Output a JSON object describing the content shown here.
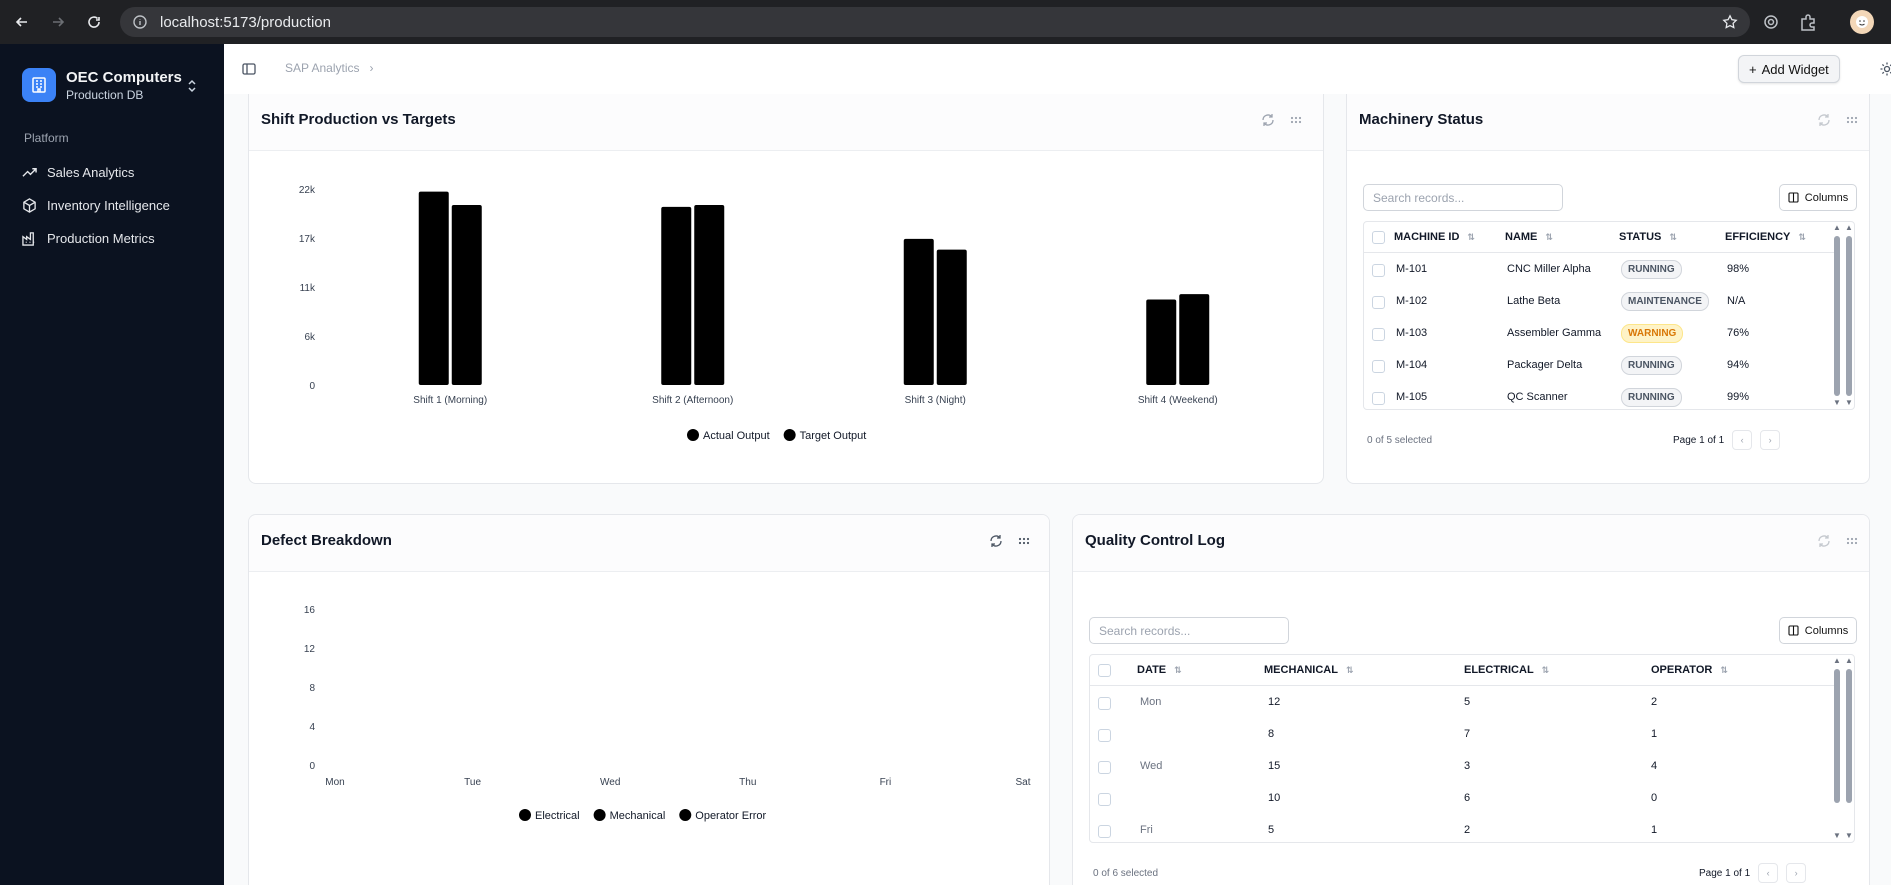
{
  "browser": {
    "url": "localhost:5173/production"
  },
  "sidebar": {
    "org_name": "OEC Computers",
    "org_sub": "Production DB",
    "section_label": "Platform",
    "items": [
      {
        "label": "Sales Analytics",
        "icon": "trending-up-icon"
      },
      {
        "label": "Inventory Intelligence",
        "icon": "package-icon"
      },
      {
        "label": "Production Metrics",
        "icon": "factory-icon"
      }
    ]
  },
  "topbar": {
    "breadcrumb_root": "SAP Analytics",
    "add_widget_label": "Add Widget"
  },
  "widgets": {
    "shift": {
      "title": "Shift Production vs Targets"
    },
    "machinery": {
      "title": "Machinery Status",
      "search_placeholder": "Search records...",
      "columns_label": "Columns",
      "headers": [
        "MACHINE ID",
        "NAME",
        "STATUS",
        "EFFICIENCY"
      ],
      "rows": [
        {
          "id": "M-101",
          "name": "CNC Miller Alpha",
          "status": "RUNNING",
          "efficiency": "98%"
        },
        {
          "id": "M-102",
          "name": "Lathe Beta",
          "status": "MAINTENANCE",
          "efficiency": "N/A"
        },
        {
          "id": "M-103",
          "name": "Assembler Gamma",
          "status": "WARNING",
          "efficiency": "76%"
        },
        {
          "id": "M-104",
          "name": "Packager Delta",
          "status": "RUNNING",
          "efficiency": "94%"
        },
        {
          "id": "M-105",
          "name": "QC Scanner",
          "status": "RUNNING",
          "efficiency": "99%"
        }
      ],
      "selected_text": "0 of 5 selected",
      "page_text": "Page 1 of 1"
    },
    "defect": {
      "title": "Defect Breakdown"
    },
    "qc": {
      "title": "Quality Control Log",
      "search_placeholder": "Search records...",
      "columns_label": "Columns",
      "headers": [
        "DATE",
        "MECHANICAL",
        "ELECTRICAL",
        "OPERATOR"
      ],
      "rows": [
        {
          "date": "Mon",
          "mechanical": "12",
          "electrical": "5",
          "operator": "2"
        },
        {
          "date": "",
          "mechanical": "8",
          "electrical": "7",
          "operator": "1"
        },
        {
          "date": "Wed",
          "mechanical": "15",
          "electrical": "3",
          "operator": "4"
        },
        {
          "date": "",
          "mechanical": "10",
          "electrical": "6",
          "operator": "0"
        },
        {
          "date": "Fri",
          "mechanical": "5",
          "electrical": "2",
          "operator": "1"
        }
      ],
      "selected_text": "0 of 6 selected",
      "page_text": "Page 1 of 1"
    }
  },
  "chart_data": [
    {
      "type": "bar",
      "categories": [
        "Shift 1 (Morning)",
        "Shift 2 (Afternoon)",
        "Shift 3 (Night)",
        "Shift 4 (Weekend)"
      ],
      "series": [
        {
          "name": "Actual Output",
          "values": [
            21700,
            20000,
            16400,
            9600
          ],
          "color": "#000000"
        },
        {
          "name": "Target Output",
          "values": [
            20200,
            20200,
            15200,
            10200
          ],
          "color": "#000000"
        }
      ],
      "yticks": [
        "0",
        "6k",
        "11k",
        "17k",
        "22k"
      ],
      "ytick_values": [
        0,
        5500,
        11000,
        16500,
        22000
      ],
      "ylim": [
        0,
        22000
      ],
      "legend": "bottom"
    },
    {
      "type": "line",
      "categories": [
        "Mon",
        "Tue",
        "Wed",
        "Thu",
        "Fri",
        "Sat"
      ],
      "series": [
        {
          "name": "Electrical",
          "values": [],
          "color": "#000000"
        },
        {
          "name": "Mechanical",
          "values": [],
          "color": "#000000"
        },
        {
          "name": "Operator Error",
          "values": [],
          "color": "#000000"
        }
      ],
      "yticks": [
        "0",
        "4",
        "8",
        "12",
        "16"
      ],
      "ylim": [
        0,
        16
      ],
      "legend": "bottom"
    }
  ]
}
